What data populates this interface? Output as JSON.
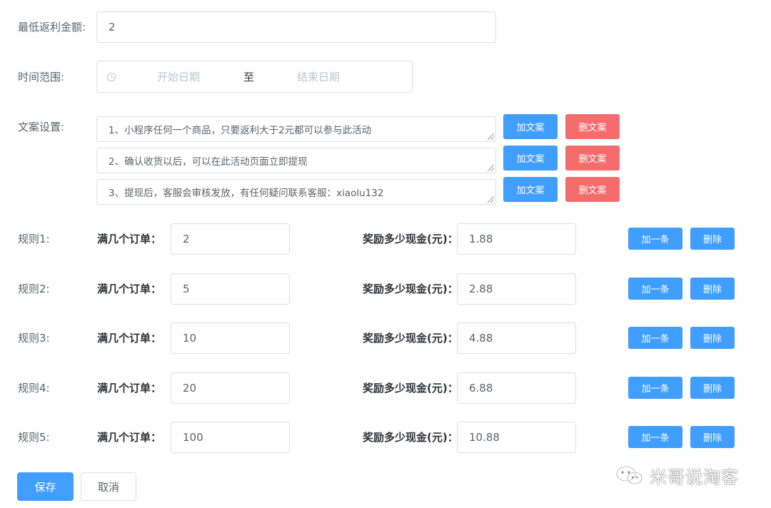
{
  "min_rebate": {
    "label": "最低返利金额:",
    "value": "2"
  },
  "time_range": {
    "label": "时间范围:",
    "start_placeholder": "开始日期",
    "separator": "至",
    "end_placeholder": "结束日期"
  },
  "copy_settings": {
    "label": "文案设置:",
    "add_label": "加文案",
    "delete_label": "删文案",
    "items": [
      "1、小程序任何一个商品，只要返利大于2元都可以参与此活动",
      "2、确认收货以后，可以在此活动页面立即提现",
      "3、提现后，客服会审核发放，有任何疑问联系客服：xiaolu132"
    ]
  },
  "rules": {
    "orders_label": "满几个订单：",
    "reward_label": "奖励多少现金(元)：",
    "add_label": "加一条",
    "delete_label": "删除",
    "items": [
      {
        "name": "规则1:",
        "orders": "2",
        "reward": "1.88"
      },
      {
        "name": "规则2:",
        "orders": "5",
        "reward": "2.88"
      },
      {
        "name": "规则3:",
        "orders": "10",
        "reward": "4.88"
      },
      {
        "name": "规则4:",
        "orders": "20",
        "reward": "6.88"
      },
      {
        "name": "规则5:",
        "orders": "100",
        "reward": "10.88"
      }
    ]
  },
  "actions": {
    "save": "保存",
    "cancel": "取消"
  },
  "watermark": {
    "text": "米哥说淘客",
    "icon": "wechat-icon"
  },
  "colors": {
    "primary": "#409eff",
    "danger": "#f56c6c",
    "border": "#dcdfe6"
  }
}
